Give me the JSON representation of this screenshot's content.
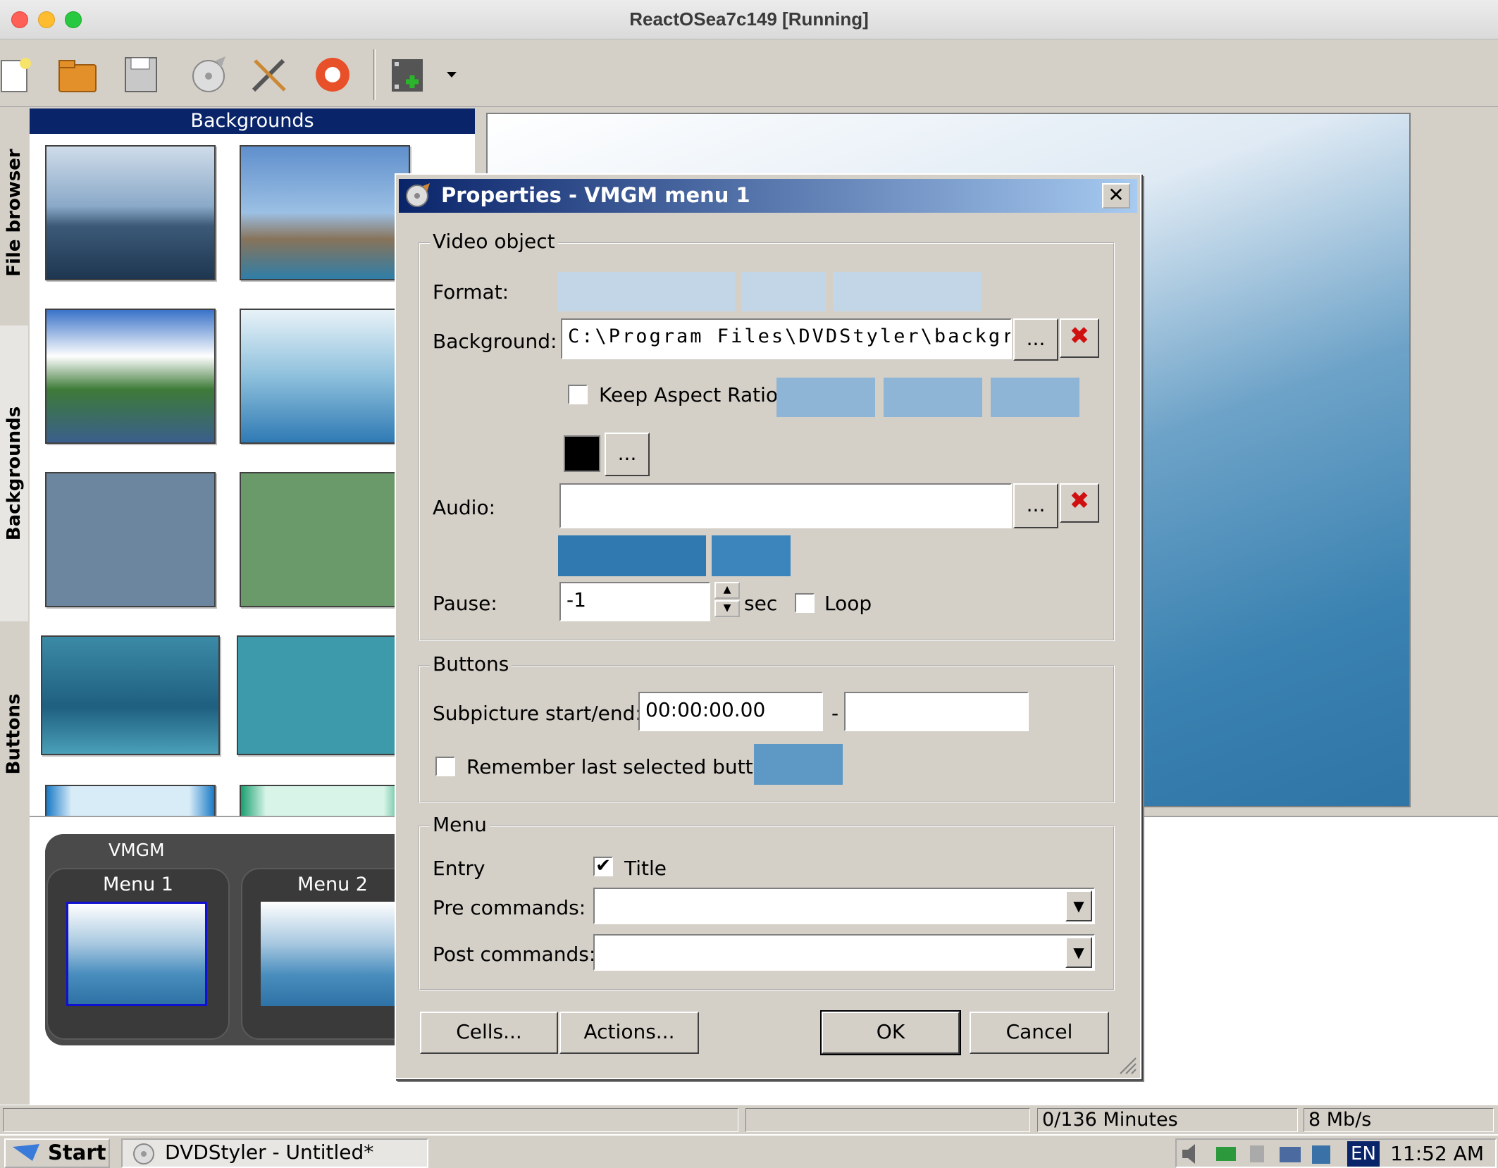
{
  "window": {
    "title": "ReactOSea7c149 [Running]"
  },
  "toolbar": {
    "icons": [
      "new-icon",
      "open-icon",
      "save-icon",
      "burn-icon",
      "settings-icon",
      "help-icon",
      "add-file-icon"
    ]
  },
  "side_tabs": {
    "file_browser": "File browser",
    "backgrounds": "Backgrounds",
    "buttons": "Buttons"
  },
  "backgrounds_panel": {
    "title": "Backgrounds"
  },
  "menus": {
    "group_label": "VMGM",
    "items": [
      {
        "label": "Menu 1"
      },
      {
        "label": "Menu 2"
      }
    ]
  },
  "dialog": {
    "title": "Properties - VMGM menu 1",
    "close_label": "✕",
    "video_object": {
      "legend": "Video object",
      "format_label": "Format:",
      "background_label": "Background:",
      "background_value": "C:\\Program Files\\DVDStyler\\backgrou",
      "browse_label": "...",
      "delete_label": "✖",
      "keep_aspect_label": "Keep Aspect Ratio",
      "keep_aspect_checked": false,
      "color_value": "#000000",
      "color_browse_label": "...",
      "audio_label": "Audio:",
      "audio_value": "",
      "pause_label": "Pause:",
      "pause_value": "-1",
      "sec_label": "sec",
      "loop_label": "Loop",
      "loop_checked": false
    },
    "buttons_group": {
      "legend": "Buttons",
      "subpicture_label": "Subpicture start/end:",
      "start_value": "00:00:00.00",
      "dash": "-",
      "end_value": "",
      "remember_label": "Remember last selected button",
      "remember_checked": false
    },
    "menu_group": {
      "legend": "Menu",
      "entry_label": "Entry",
      "title_label": "Title",
      "title_checked": true,
      "check_mark": "✔",
      "pre_label": "Pre commands:",
      "pre_value": "",
      "post_label": "Post commands:",
      "post_value": "",
      "dropdown_arrow": "▼"
    },
    "cells_label": "Cells...",
    "actions_label": "Actions...",
    "ok_label": "OK",
    "cancel_label": "Cancel"
  },
  "status": {
    "minutes": "0/136 Minutes",
    "bitrate": "8 Mb/s"
  },
  "taskbar": {
    "start_label": "Start",
    "task_label": "DVDStyler - Untitled*",
    "tray_lang": "EN",
    "clock": "11:52 AM"
  }
}
